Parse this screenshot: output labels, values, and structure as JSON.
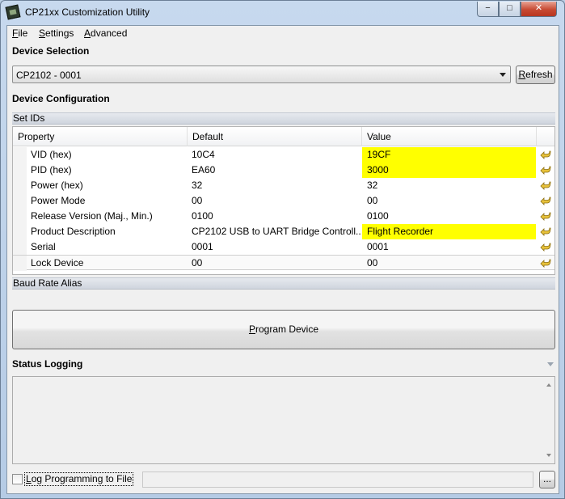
{
  "window": {
    "title": "CP21xx Customization Utility",
    "controls": {
      "minimize": "−",
      "maximize": "□",
      "close": "✕"
    }
  },
  "menu": [
    {
      "accel": "F",
      "rest": "ile"
    },
    {
      "accel": "S",
      "rest": "ettings"
    },
    {
      "accel": "A",
      "rest": "dvanced"
    }
  ],
  "device_selection": {
    "title": "Device Selection",
    "selected_device": "CP2102 - 0001",
    "refresh_accel": "R",
    "refresh_rest": "efresh"
  },
  "device_configuration": {
    "title": "Device Configuration",
    "set_ids_label": "Set IDs",
    "columns": [
      "Property",
      "Default",
      "Value"
    ],
    "rows": [
      {
        "property": "VID (hex)",
        "default": "10C4",
        "value": "19CF",
        "highlight": true
      },
      {
        "property": "PID (hex)",
        "default": "EA60",
        "value": "3000",
        "highlight": true
      },
      {
        "property": "Power (hex)",
        "default": "32",
        "value": "32",
        "highlight": false
      },
      {
        "property": "Power Mode",
        "default": "00",
        "value": "00",
        "highlight": false
      },
      {
        "property": "Release Version (Maj., Min.)",
        "default": "0100",
        "value": "0100",
        "highlight": false
      },
      {
        "property": "Product Description",
        "default": "CP2102 USB to UART Bridge Controll...",
        "value": "Flight Recorder",
        "highlight": true
      },
      {
        "property": "Serial",
        "default": "0001",
        "value": "0001",
        "highlight": false
      },
      {
        "property": "Lock Device",
        "default": "00",
        "value": "00",
        "highlight": false
      }
    ],
    "baud_rate_alias_label": "Baud Rate Alias"
  },
  "program": {
    "accel": "P",
    "rest": "rogram Device"
  },
  "status_logging": {
    "title": "Status Logging",
    "log_label_accel": "L",
    "log_label_rest": "og Programming to File",
    "log_checked": false,
    "browse_label": "..."
  },
  "colors": {
    "highlight": "#ffff00",
    "undo_icon": "#e8c23a"
  }
}
